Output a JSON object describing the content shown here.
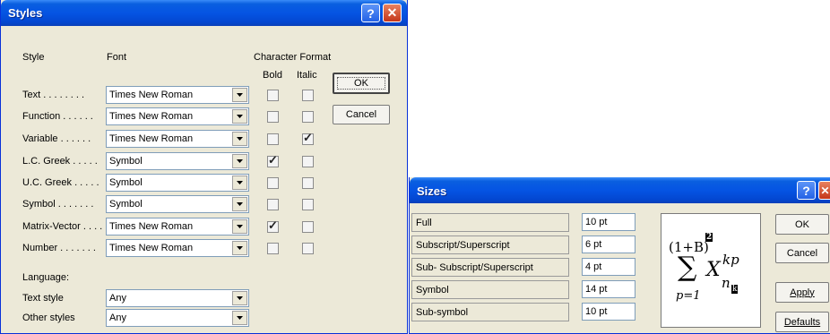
{
  "styles_dialog": {
    "title": "Styles",
    "help_glyph": "?",
    "close_glyph": "✕",
    "headers": {
      "style": "Style",
      "font": "Font",
      "character_format": "Character Format",
      "bold": "Bold",
      "italic": "Italic"
    },
    "rows": [
      {
        "label": "Text . . . . . . . .",
        "font": "Times New Roman",
        "bold": false,
        "italic": false
      },
      {
        "label": "Function . . . . . .",
        "font": "Times New Roman",
        "bold": false,
        "italic": false
      },
      {
        "label": "Variable . . . . . .",
        "font": "Times New Roman",
        "bold": false,
        "italic": true
      },
      {
        "label": "L.C. Greek . . . . .",
        "font": "Symbol",
        "bold": true,
        "italic": false
      },
      {
        "label": "U.C. Greek . . . . .",
        "font": "Symbol",
        "bold": false,
        "italic": false
      },
      {
        "label": "Symbol . . . . . . .",
        "font": "Symbol",
        "bold": false,
        "italic": false
      },
      {
        "label": "Matrix-Vector . . . .",
        "font": "Times New Roman",
        "bold": true,
        "italic": false
      },
      {
        "label": "Number . . . . . . .",
        "font": "Times New Roman",
        "bold": false,
        "italic": false
      }
    ],
    "language_label": "Language:",
    "text_style_label": "Text style",
    "text_style_value": "Any",
    "other_styles_label": "Other styles",
    "other_styles_value": "Any",
    "ok_label": "OK",
    "cancel_label": "Cancel",
    "check_glyph": "✓"
  },
  "sizes_dialog": {
    "title": "Sizes",
    "help_glyph": "?",
    "rows": [
      {
        "label": "Full",
        "value": "10 pt"
      },
      {
        "label": "Subscript/Superscript",
        "value": "6 pt"
      },
      {
        "label": "Sub- Subscript/Superscript",
        "value": "4 pt"
      },
      {
        "label": "Symbol",
        "value": "14 pt"
      },
      {
        "label": "Sub-symbol",
        "value": "10 pt"
      }
    ],
    "ok_label": "OK",
    "cancel_label": "Cancel",
    "apply_label": "Apply",
    "defaults_label": "Defaults",
    "preview": {
      "base": "(1+B)",
      "base_sup": "2",
      "sum": "∑",
      "lower": "p=1",
      "var": "X",
      "var_sup": "kp",
      "var_sub": "n",
      "var_subsub": "k"
    }
  }
}
